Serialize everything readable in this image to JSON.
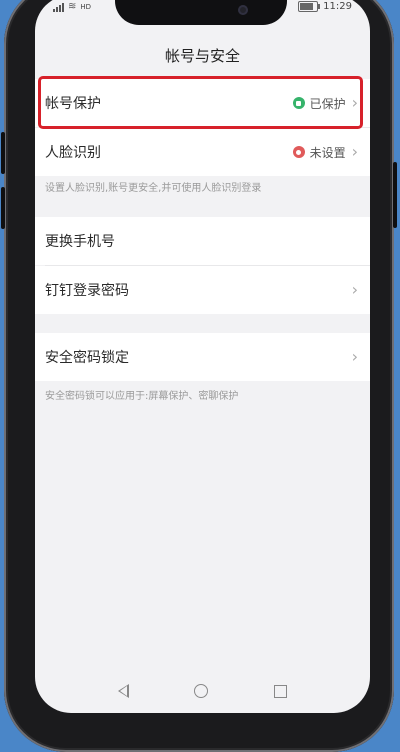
{
  "status_bar": {
    "network": "HD",
    "speed": "0\nB/s",
    "battery_icon": "battery-icon",
    "time": "11:29",
    "battery_level": 0.7
  },
  "page": {
    "title": "帐号与安全"
  },
  "items": {
    "account_protection": {
      "label": "帐号保护",
      "status": "已保护",
      "status_color": "#36b36b"
    },
    "face_recognition": {
      "label": "人脸识别",
      "status": "未设置",
      "status_color": "#e05a5a"
    },
    "face_hint": "设置人脸识别,账号更安全,并可使用人脸识别登录",
    "change_phone": {
      "label": "更换手机号"
    },
    "dingtalk_password": {
      "label": "钉钉登录密码"
    },
    "security_lock": {
      "label": "安全密码锁定"
    },
    "lock_hint": "安全密码锁可以应用于:屏幕保护、密聊保护"
  },
  "accent": {
    "highlight": "#d7212a",
    "background": "#4a86c8"
  }
}
